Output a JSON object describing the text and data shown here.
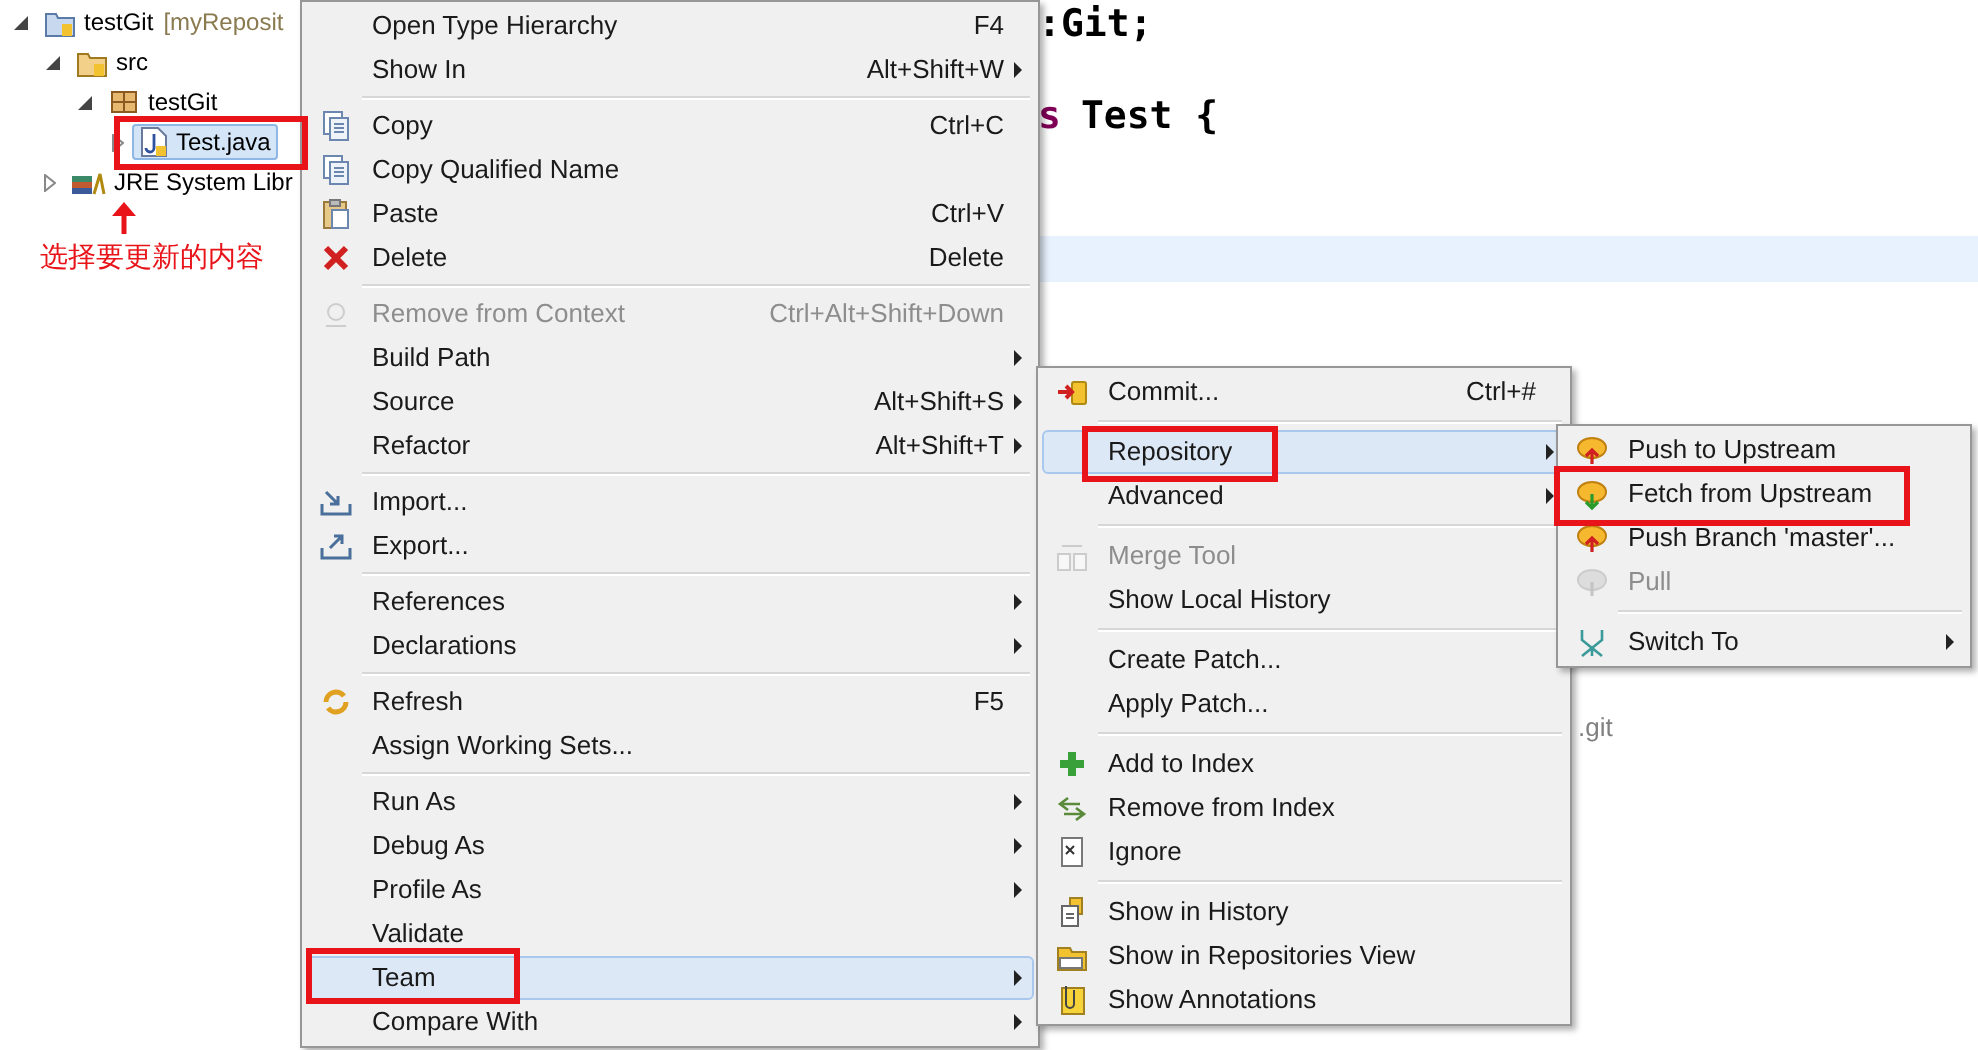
{
  "tree": [
    {
      "kind": "project",
      "label": "testGit",
      "suffix": "[myReposit",
      "expanded": true,
      "children": [
        {
          "kind": "source_folder",
          "label": "src",
          "expanded": true,
          "children": [
            {
              "kind": "package",
              "label": "testGit",
              "expanded": true,
              "children": [
                {
                  "kind": "java_file",
                  "label": "Test.java",
                  "expanded": false,
                  "selected": true
                }
              ]
            }
          ]
        },
        {
          "kind": "library",
          "label": "JRE System Libr",
          "expanded": false,
          "selected": false
        }
      ]
    }
  ],
  "editor": {
    "code_lines": [
      {
        "text": ":Git;",
        "current": false
      },
      {
        "keyword": "s",
        "text": "Test {",
        "current": false
      },
      {
        "current": true
      }
    ],
    "path_fragment": ".git"
  },
  "context_menu": {
    "groups": [
      [
        {
          "label": "Open Type Hierarchy",
          "shortcut": "F4",
          "submenu": false,
          "disabled": false,
          "selected": false
        },
        {
          "label": "Show In",
          "shortcut": "Alt+Shift+W",
          "submenu": true,
          "disabled": false,
          "selected": false
        }
      ],
      [
        {
          "label": "Copy",
          "shortcut": "Ctrl+C",
          "submenu": false,
          "disabled": false,
          "selected": false
        },
        {
          "label": "Copy Qualified Name",
          "submenu": false,
          "disabled": false,
          "selected": false
        },
        {
          "label": "Paste",
          "shortcut": "Ctrl+V",
          "submenu": false,
          "disabled": false,
          "selected": false
        },
        {
          "label": "Delete",
          "shortcut": "Delete",
          "submenu": false,
          "disabled": false,
          "selected": false
        }
      ],
      [
        {
          "label": "Remove from Context",
          "shortcut": "Ctrl+Alt+Shift+Down",
          "submenu": false,
          "disabled": true,
          "selected": false
        },
        {
          "label": "Build Path",
          "submenu": true,
          "disabled": false,
          "selected": false
        },
        {
          "label": "Source",
          "shortcut": "Alt+Shift+S",
          "submenu": true,
          "disabled": false,
          "selected": false
        },
        {
          "label": "Refactor",
          "shortcut": "Alt+Shift+T",
          "submenu": true,
          "disabled": false,
          "selected": false
        }
      ],
      [
        {
          "label": "Import...",
          "submenu": false,
          "disabled": false,
          "selected": false
        },
        {
          "label": "Export...",
          "submenu": false,
          "disabled": false,
          "selected": false
        }
      ],
      [
        {
          "label": "References",
          "submenu": true,
          "disabled": false,
          "selected": false
        },
        {
          "label": "Declarations",
          "submenu": true,
          "disabled": false,
          "selected": false
        }
      ],
      [
        {
          "label": "Refresh",
          "shortcut": "F5",
          "submenu": false,
          "disabled": false,
          "selected": false
        },
        {
          "label": "Assign Working Sets...",
          "submenu": false,
          "disabled": false,
          "selected": false
        }
      ],
      [
        {
          "label": "Run As",
          "submenu": true,
          "disabled": false,
          "selected": false
        },
        {
          "label": "Debug As",
          "submenu": true,
          "disabled": false,
          "selected": false
        },
        {
          "label": "Profile As",
          "submenu": true,
          "disabled": false,
          "selected": false
        },
        {
          "label": "Validate",
          "submenu": false,
          "disabled": false,
          "selected": false
        },
        {
          "label": "Team",
          "submenu": true,
          "disabled": false,
          "selected": true
        },
        {
          "label": "Compare With",
          "submenu": true,
          "disabled": false,
          "selected": false
        }
      ]
    ]
  },
  "team_menu": {
    "groups": [
      [
        {
          "label": "Commit...",
          "shortcut": "Ctrl+#",
          "submenu": false,
          "disabled": false,
          "selected": false
        }
      ],
      [
        {
          "label": "Repository",
          "submenu": true,
          "disabled": false,
          "selected": true
        },
        {
          "label": "Advanced",
          "submenu": true,
          "disabled": false,
          "selected": false
        }
      ],
      [
        {
          "label": "Merge Tool",
          "submenu": false,
          "disabled": true,
          "selected": false
        },
        {
          "label": "Show Local History",
          "submenu": false,
          "disabled": false,
          "selected": false
        }
      ],
      [
        {
          "label": "Create Patch...",
          "submenu": false,
          "disabled": false,
          "selected": false
        },
        {
          "label": "Apply Patch...",
          "submenu": false,
          "disabled": false,
          "selected": false
        }
      ],
      [
        {
          "label": "Add to Index",
          "submenu": false,
          "disabled": false,
          "selected": false
        },
        {
          "label": "Remove from Index",
          "submenu": false,
          "disabled": false,
          "selected": false
        },
        {
          "label": "Ignore",
          "submenu": false,
          "disabled": false,
          "selected": false
        }
      ],
      [
        {
          "label": "Show in History",
          "submenu": false,
          "disabled": false,
          "selected": false
        },
        {
          "label": "Show in Repositories View",
          "submenu": false,
          "disabled": false,
          "selected": false
        },
        {
          "label": "Show Annotations",
          "submenu": false,
          "disabled": false,
          "selected": false
        }
      ]
    ]
  },
  "repository_menu": {
    "groups": [
      [
        {
          "label": "Push to Upstream",
          "submenu": false,
          "disabled": false,
          "selected": false
        },
        {
          "label": "Fetch from Upstream",
          "submenu": false,
          "disabled": false,
          "selected": false
        },
        {
          "label": "Push Branch 'master'...",
          "submenu": false,
          "disabled": false,
          "selected": false
        },
        {
          "label": "Pull",
          "submenu": false,
          "disabled": true,
          "selected": false
        }
      ],
      [
        {
          "label": "Switch To",
          "submenu": true,
          "disabled": false,
          "selected": false
        }
      ]
    ]
  },
  "annotation": {
    "text": "选择要更新的内容"
  }
}
